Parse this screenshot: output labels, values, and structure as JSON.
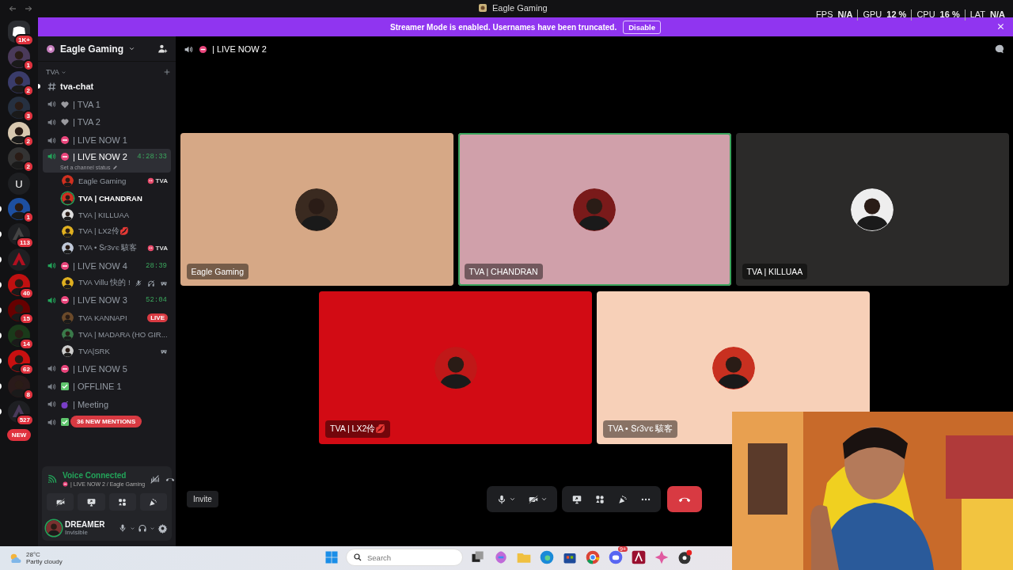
{
  "titlebar": {
    "title": "Eagle Gaming"
  },
  "overlay_stats": [
    {
      "label": "FPS",
      "value": "N/A"
    },
    {
      "label": "GPU",
      "value": "12 %"
    },
    {
      "label": "CPU",
      "value": "16 %"
    },
    {
      "label": "LAT",
      "value": "N/A"
    }
  ],
  "banner": {
    "text": "Streamer Mode is enabled. Usernames have been truncated.",
    "button": "Disable"
  },
  "servers": [
    {
      "kind": "home",
      "badge": "1K+",
      "unread": false
    },
    {
      "kind": "avatar",
      "badge": "1",
      "unread": false
    },
    {
      "kind": "avatar",
      "badge": "2",
      "unread": false
    },
    {
      "kind": "avatar",
      "badge": "3",
      "unread": false
    },
    {
      "kind": "avatar",
      "badge": "2",
      "unread": false
    },
    {
      "kind": "avatar",
      "badge": "2",
      "unread": false
    },
    {
      "kind": "letter",
      "letter": "U",
      "unread": false
    },
    {
      "kind": "avatar",
      "badge": "1",
      "unread": true
    },
    {
      "kind": "logo",
      "badge": "113",
      "unread": true
    },
    {
      "kind": "logo",
      "unread": true
    },
    {
      "kind": "avatar",
      "badge": "40",
      "unread": true
    },
    {
      "kind": "avatar",
      "badge": "15",
      "unread": true
    },
    {
      "kind": "avatar",
      "badge": "14",
      "unread": true
    },
    {
      "kind": "avatar",
      "badge": "62",
      "unread": true
    },
    {
      "kind": "avatar",
      "badge": "8",
      "unread": true
    },
    {
      "kind": "logo",
      "badge": "527",
      "unread": true
    },
    {
      "kind": "new",
      "badge": "NEW",
      "unread": false
    }
  ],
  "server": {
    "name": "Eagle Gaming"
  },
  "category": {
    "name": "TVA"
  },
  "channels": [
    {
      "kind": "text",
      "name": "tva-chat",
      "unread": true,
      "selected": false
    },
    {
      "kind": "voice",
      "status_icon": {
        "kind": "heart"
      },
      "name": "| TVA 1",
      "active": false,
      "selected": false
    },
    {
      "kind": "voice",
      "status_icon": {
        "kind": "heart"
      },
      "name": "| TVA 2",
      "active": false,
      "selected": false
    },
    {
      "kind": "voice",
      "status_icon": {
        "kind": "no-entry"
      },
      "name": "| LIVE NOW 1",
      "active": false,
      "selected": false
    },
    {
      "kind": "voice",
      "status_icon": {
        "kind": "no-entry"
      },
      "name": "| LIVE NOW 2",
      "active": true,
      "selected": true,
      "timer": "4:28:33",
      "channel_status": "Set a channel status",
      "users": [
        {
          "name": "Eagle Gaming",
          "speaking": false,
          "tag": "TVA"
        },
        {
          "name": "TVA | CHANDRAN",
          "speaking": true
        },
        {
          "name": "TVA | KILLUAA",
          "speaking": false
        },
        {
          "name": "TVA | LX2伶💋",
          "speaking": false
        },
        {
          "name": "TVA • Տɾ3ⱱє 駭客",
          "speaking": false,
          "tag": "TVA"
        }
      ]
    },
    {
      "kind": "voice",
      "status_icon": {
        "kind": "no-entry"
      },
      "name": "| LIVE NOW 4",
      "active": true,
      "selected": false,
      "timer": "28:39",
      "users": [
        {
          "name": "TVA Villu 快的 !",
          "speaking": false,
          "icons": [
            {
              "kind": "mute"
            },
            {
              "kind": "deafen"
            },
            {
              "kind": "game"
            }
          ]
        }
      ]
    },
    {
      "kind": "voice",
      "status_icon": {
        "kind": "no-entry"
      },
      "name": "| LIVE NOW 3",
      "active": true,
      "selected": false,
      "timer": "52:04",
      "users": [
        {
          "name": "TVA KANNAPI",
          "speaking": false,
          "live": "LIVE"
        },
        {
          "name": "TVA | MADARA (HO GIR...",
          "speaking": false
        },
        {
          "name": "TVA|SRK",
          "speaking": false,
          "icons": [
            {
              "kind": "game"
            }
          ]
        }
      ]
    },
    {
      "kind": "voice",
      "status_icon": {
        "kind": "no-entry"
      },
      "name": "| LIVE NOW 5",
      "active": false,
      "selected": false
    },
    {
      "kind": "voice",
      "status_icon": {
        "kind": "check"
      },
      "name": "| OFFLINE 1",
      "active": false,
      "selected": false
    },
    {
      "kind": "voice",
      "status_icon": {
        "kind": "bomb"
      },
      "name": "| Meeting",
      "active": false,
      "selected": false
    },
    {
      "kind": "voice",
      "status_icon": {
        "kind": "check"
      },
      "active": false,
      "selected": false
    }
  ],
  "mentions_pill": "36 NEW MENTIONS",
  "voice_panel": {
    "title": "Voice Connected",
    "status_icon": {
      "kind": "no-entry"
    },
    "location": "| LIVE NOW 2 / Eagle Gaming"
  },
  "user_panel": {
    "name": "DREAMER",
    "status": "Invisible"
  },
  "call": {
    "status_icon": {
      "kind": "no-entry"
    },
    "channel": "| LIVE NOW 2",
    "invite": "Invite"
  },
  "tiles": [
    {
      "name": "Eagle Gaming",
      "color": "#d6a886",
      "speaking": false
    },
    {
      "name": "TVA | CHANDRAN",
      "color": "#d0a0aa",
      "speaking": true
    },
    {
      "name": "TVA | KILLUAA",
      "color": "#2b2a29",
      "speaking": false
    },
    {
      "name": "TVA | LX2伶💋",
      "color": "#d20b14",
      "speaking": false
    },
    {
      "name": "TVA • Տɾ3ⱱє 駭客",
      "color": "#f7d0b8",
      "speaking": false
    }
  ],
  "taskbar": {
    "temperature": "28°C",
    "weather": "Partly cloudy",
    "search_placeholder": "Search",
    "discord_badge": "9+"
  }
}
